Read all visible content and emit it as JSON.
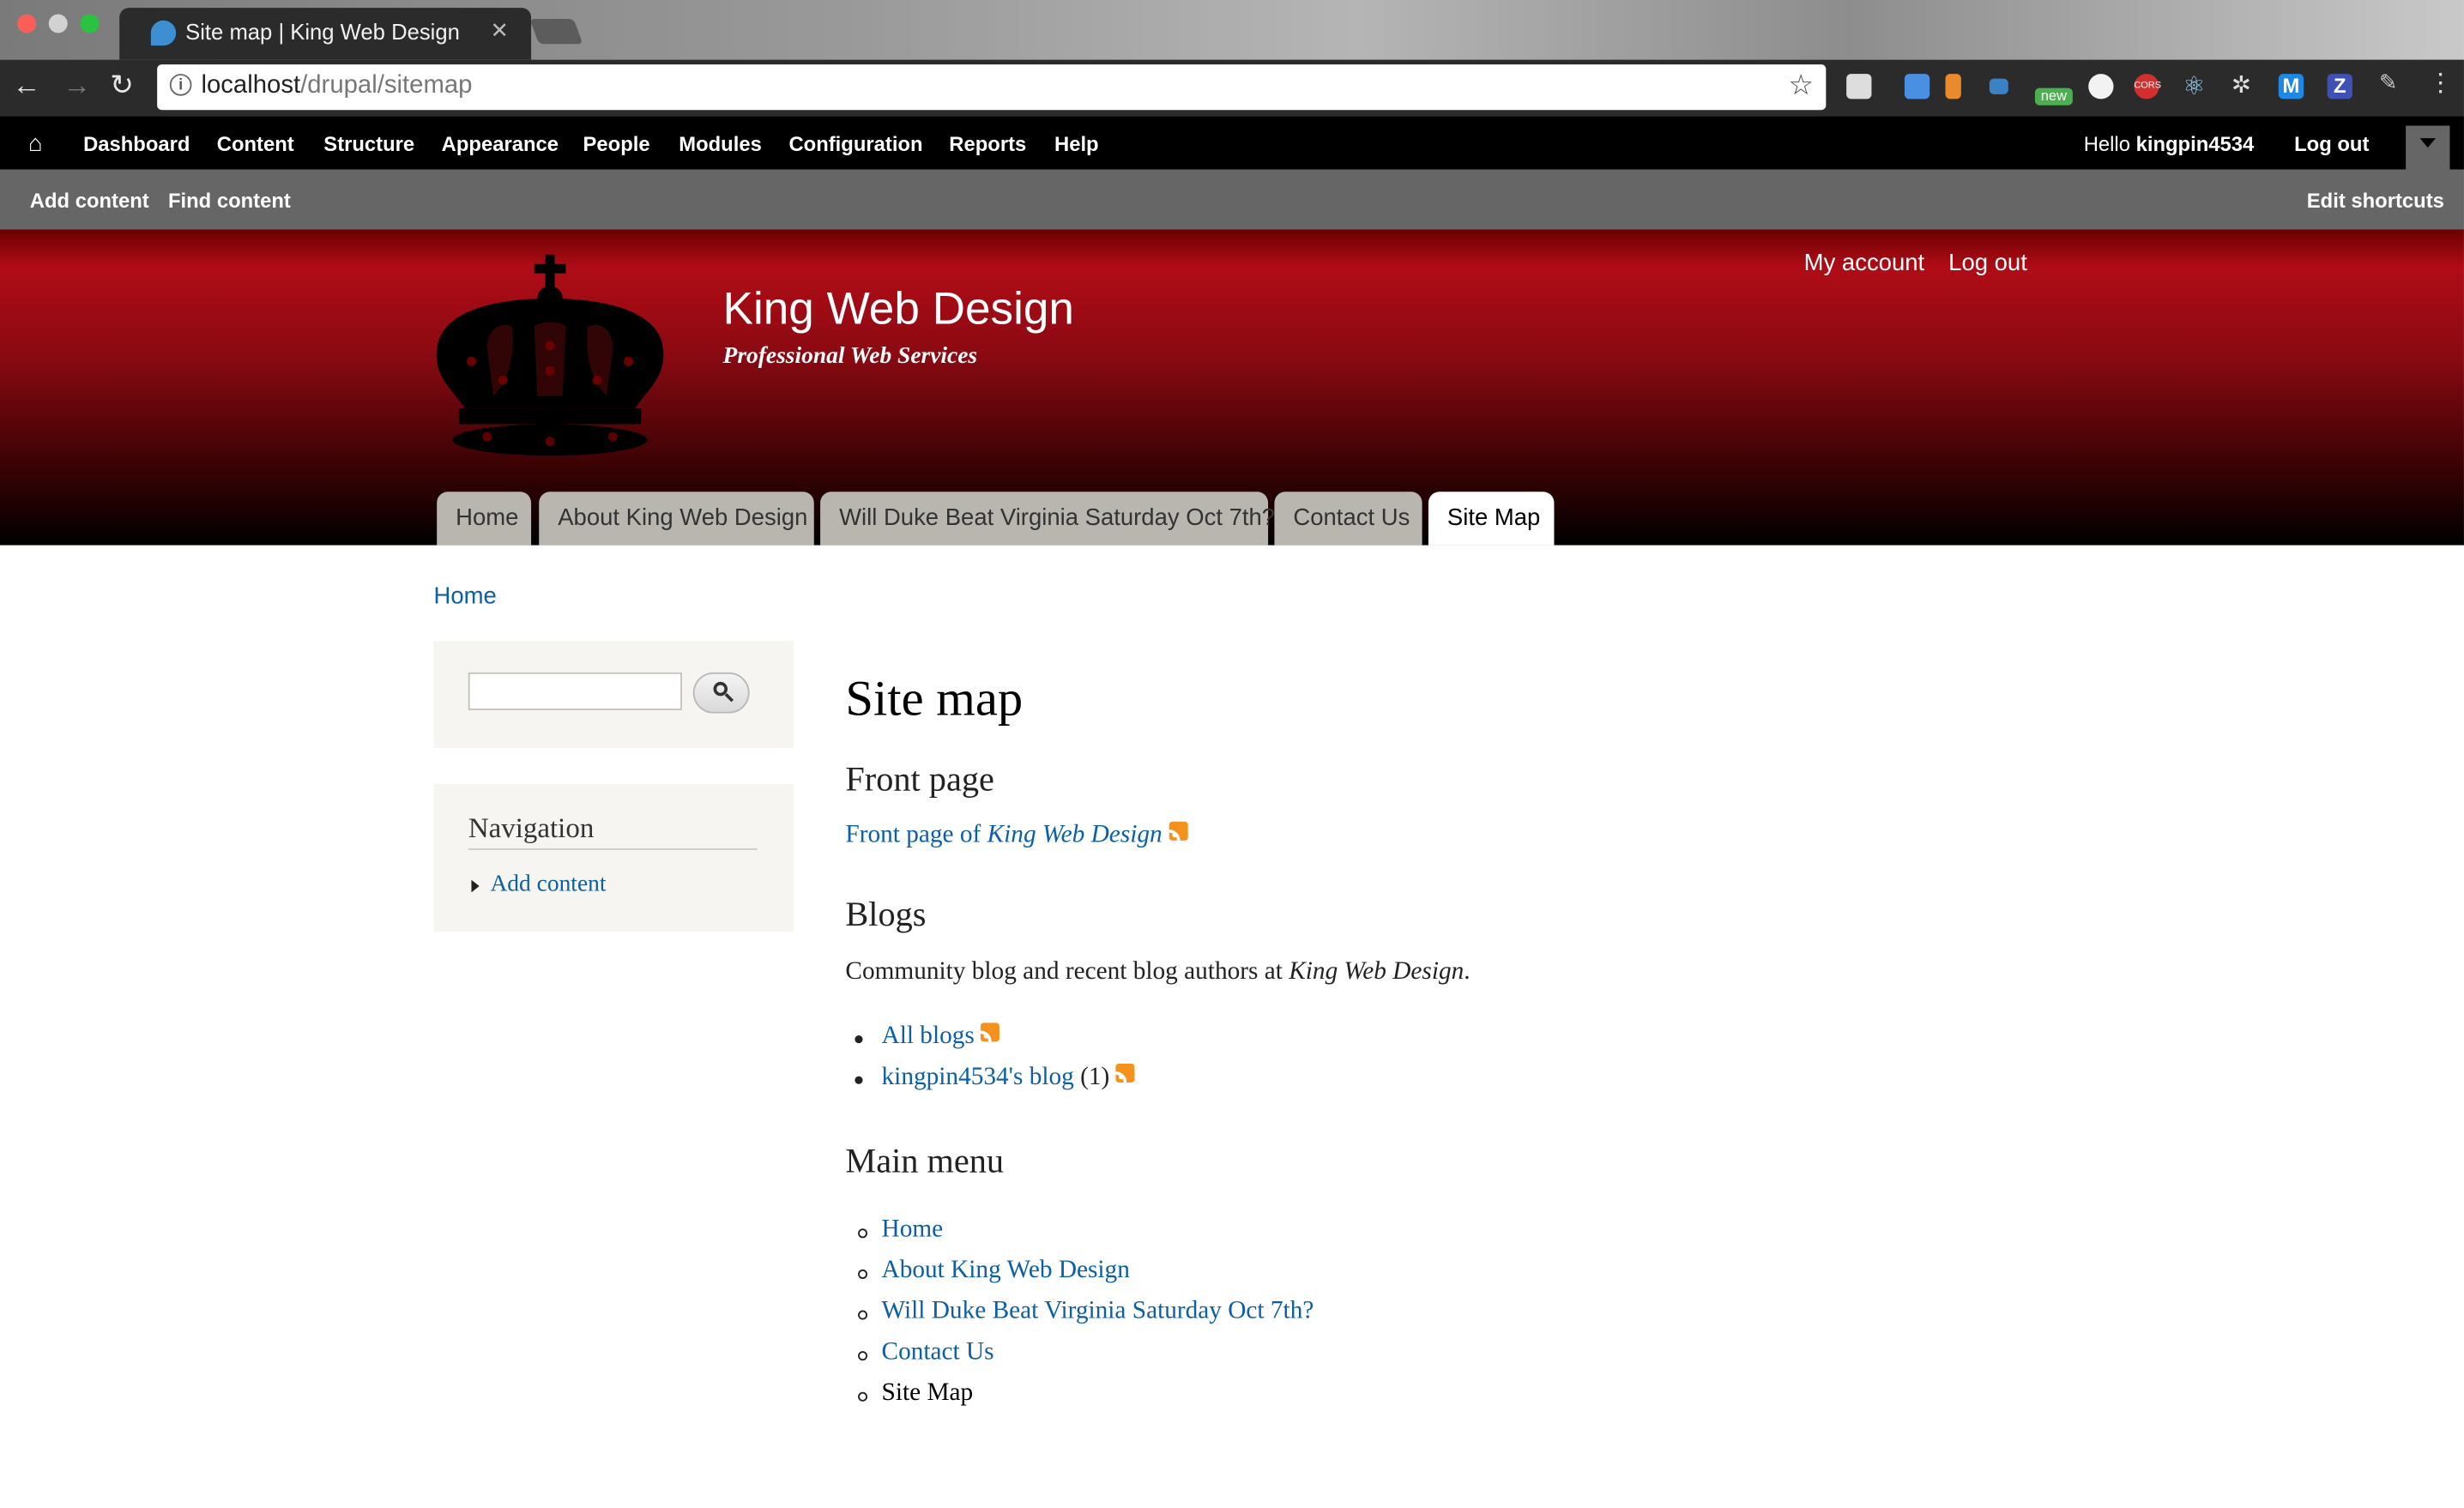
{
  "browser": {
    "tab_title": "Site map | King Web Design",
    "url_host": "localhost",
    "url_path": "/drupal/sitemap",
    "ext_new_badge": "new",
    "ext_cors_badge": "CORS",
    "ext_m": "M",
    "ext_z": "Z"
  },
  "admin_toolbar": {
    "items": [
      "Dashboard",
      "Content",
      "Structure",
      "Appearance",
      "People",
      "Modules",
      "Configuration",
      "Reports",
      "Help"
    ],
    "hello_prefix": "Hello ",
    "username": "kingpin4534",
    "logout": "Log out"
  },
  "shortcuts": {
    "add_content": "Add content",
    "find_content": "Find content",
    "edit_shortcuts": "Edit shortcuts"
  },
  "header": {
    "site_name": "King Web Design",
    "slogan": "Professional Web Services",
    "my_account": "My account",
    "log_out": "Log out",
    "main_tabs": [
      "Home",
      "About King Web Design",
      "Will Duke Beat Virginia Saturday Oct 7th?",
      "Contact Us",
      "Site Map"
    ],
    "active_tab": "Site Map"
  },
  "breadcrumb": "Home",
  "sidebar": {
    "search_value": "",
    "nav_title": "Navigation",
    "nav_items": [
      "Add content"
    ]
  },
  "content": {
    "page_title": "Site map",
    "front_page": {
      "heading": "Front page",
      "link_prefix": "Front page of ",
      "link_site": "King Web Design"
    },
    "blogs": {
      "heading": "Blogs",
      "desc_prefix": "Community blog and recent blog authors at ",
      "desc_site": "King Web Design",
      "desc_suffix": ".",
      "items": [
        {
          "label": "All blogs",
          "count": ""
        },
        {
          "label": "kingpin4534's blog",
          "count": "(1)"
        }
      ]
    },
    "main_menu": {
      "heading": "Main menu",
      "items": [
        "Home",
        "About King Web Design",
        "Will Duke Beat Virginia Saturday Oct 7th?",
        "Contact Us",
        "Site Map"
      ]
    }
  },
  "colors": {
    "link": "#0b5fa6",
    "header_red": "#b00c16",
    "admin_bar": "#000000",
    "shortcut_bar": "#666666"
  }
}
